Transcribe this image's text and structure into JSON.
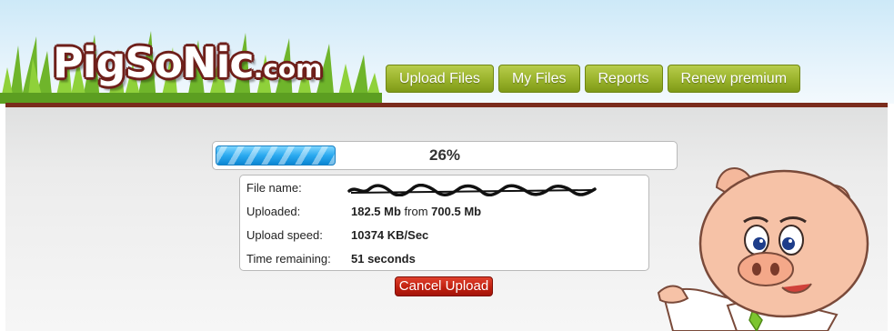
{
  "header": {
    "logo": {
      "main": "PigSoNic",
      "suffix": ".com"
    },
    "nav": [
      {
        "label": "Upload Files"
      },
      {
        "label": "My Files"
      },
      {
        "label": "Reports"
      },
      {
        "label": "Renew premium"
      }
    ]
  },
  "upload": {
    "progress_percent": 26,
    "progress_text": "26%",
    "fields": {
      "file_name_label": "File name:",
      "file_name_value": "",
      "uploaded_label": "Uploaded:",
      "uploaded_amount": "182.5 Mb",
      "uploaded_from": "from",
      "uploaded_total": "700.5 Mb",
      "speed_label": "Upload speed:",
      "speed_value": "10374 KB/Sec",
      "remaining_label": "Time remaining:",
      "remaining_value": "51 seconds"
    },
    "cancel_label": "Cancel Upload"
  },
  "colors": {
    "nav_green": "#9cb52e",
    "rule_brown": "#7a2c1c",
    "progress_blue": "#2aa9ef",
    "cancel_red": "#c0200f"
  }
}
